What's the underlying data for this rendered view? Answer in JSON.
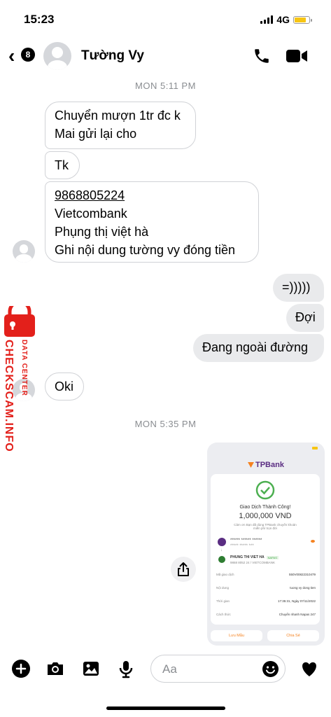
{
  "status_bar": {
    "time": "15:23",
    "network": "4G"
  },
  "header": {
    "back_badge": "8",
    "contact_name": "Tường Vy"
  },
  "timestamps": {
    "first": "MON 5:11 PM",
    "second": "MON 5:35 PM"
  },
  "messages": {
    "m1_line1": "Chuyển mượn 1tr đc k",
    "m1_line2": "Mai gửi lại cho",
    "m2": "Tk",
    "m3_account": "9868805224",
    "m3_bank": "Vietcombank",
    "m3_name": "Phụng thị việt hà",
    "m3_note": "Ghi nội dung tường vy đóng tiền",
    "out1": "=)))))",
    "out2": "Đợi",
    "out3": "Đang ngoài đường",
    "in_oki": "Oki"
  },
  "receipt": {
    "bank_logo": "TPBank",
    "status": "Giao Dịch Thành Công!",
    "amount": "1,000,000 VND",
    "thanks": "Cảm ơn Bạn đã dùng TPBank chuyển khoản miễn phí trọn đời",
    "sender_masked": "****** ****** ******",
    "sender_acct": "***** ***** ***",
    "recipient_name": "PHUNG THI VIET HA",
    "recipient_tag": "NAPAS",
    "recipient_acct": "9868 8052 24 / VIETCOMBANK",
    "rows": [
      {
        "label": "Mã giao dịch",
        "value": "550V00822310479"
      },
      {
        "label": "Nội dung",
        "value": "tuong vy dong tien"
      },
      {
        "label": "Thời gian",
        "value": "17:35:31, Ngày 07/11/2022"
      },
      {
        "label": "Cách thức",
        "value": "Chuyển nhanh Napas 247"
      }
    ],
    "btn_save": "Lưu Mẫu",
    "btn_share": "Chia Sẻ"
  },
  "composer": {
    "placeholder": "Aa"
  },
  "watermark": {
    "brand": "CHECKSCAM.INFO",
    "sub": "DATA CENTER"
  },
  "colors": {
    "accent": "#000000",
    "bubble_out": "#e9eaec",
    "watermark": "#e3201b",
    "tpbank_purple": "#5a2d82",
    "success_green": "#4caf50"
  }
}
